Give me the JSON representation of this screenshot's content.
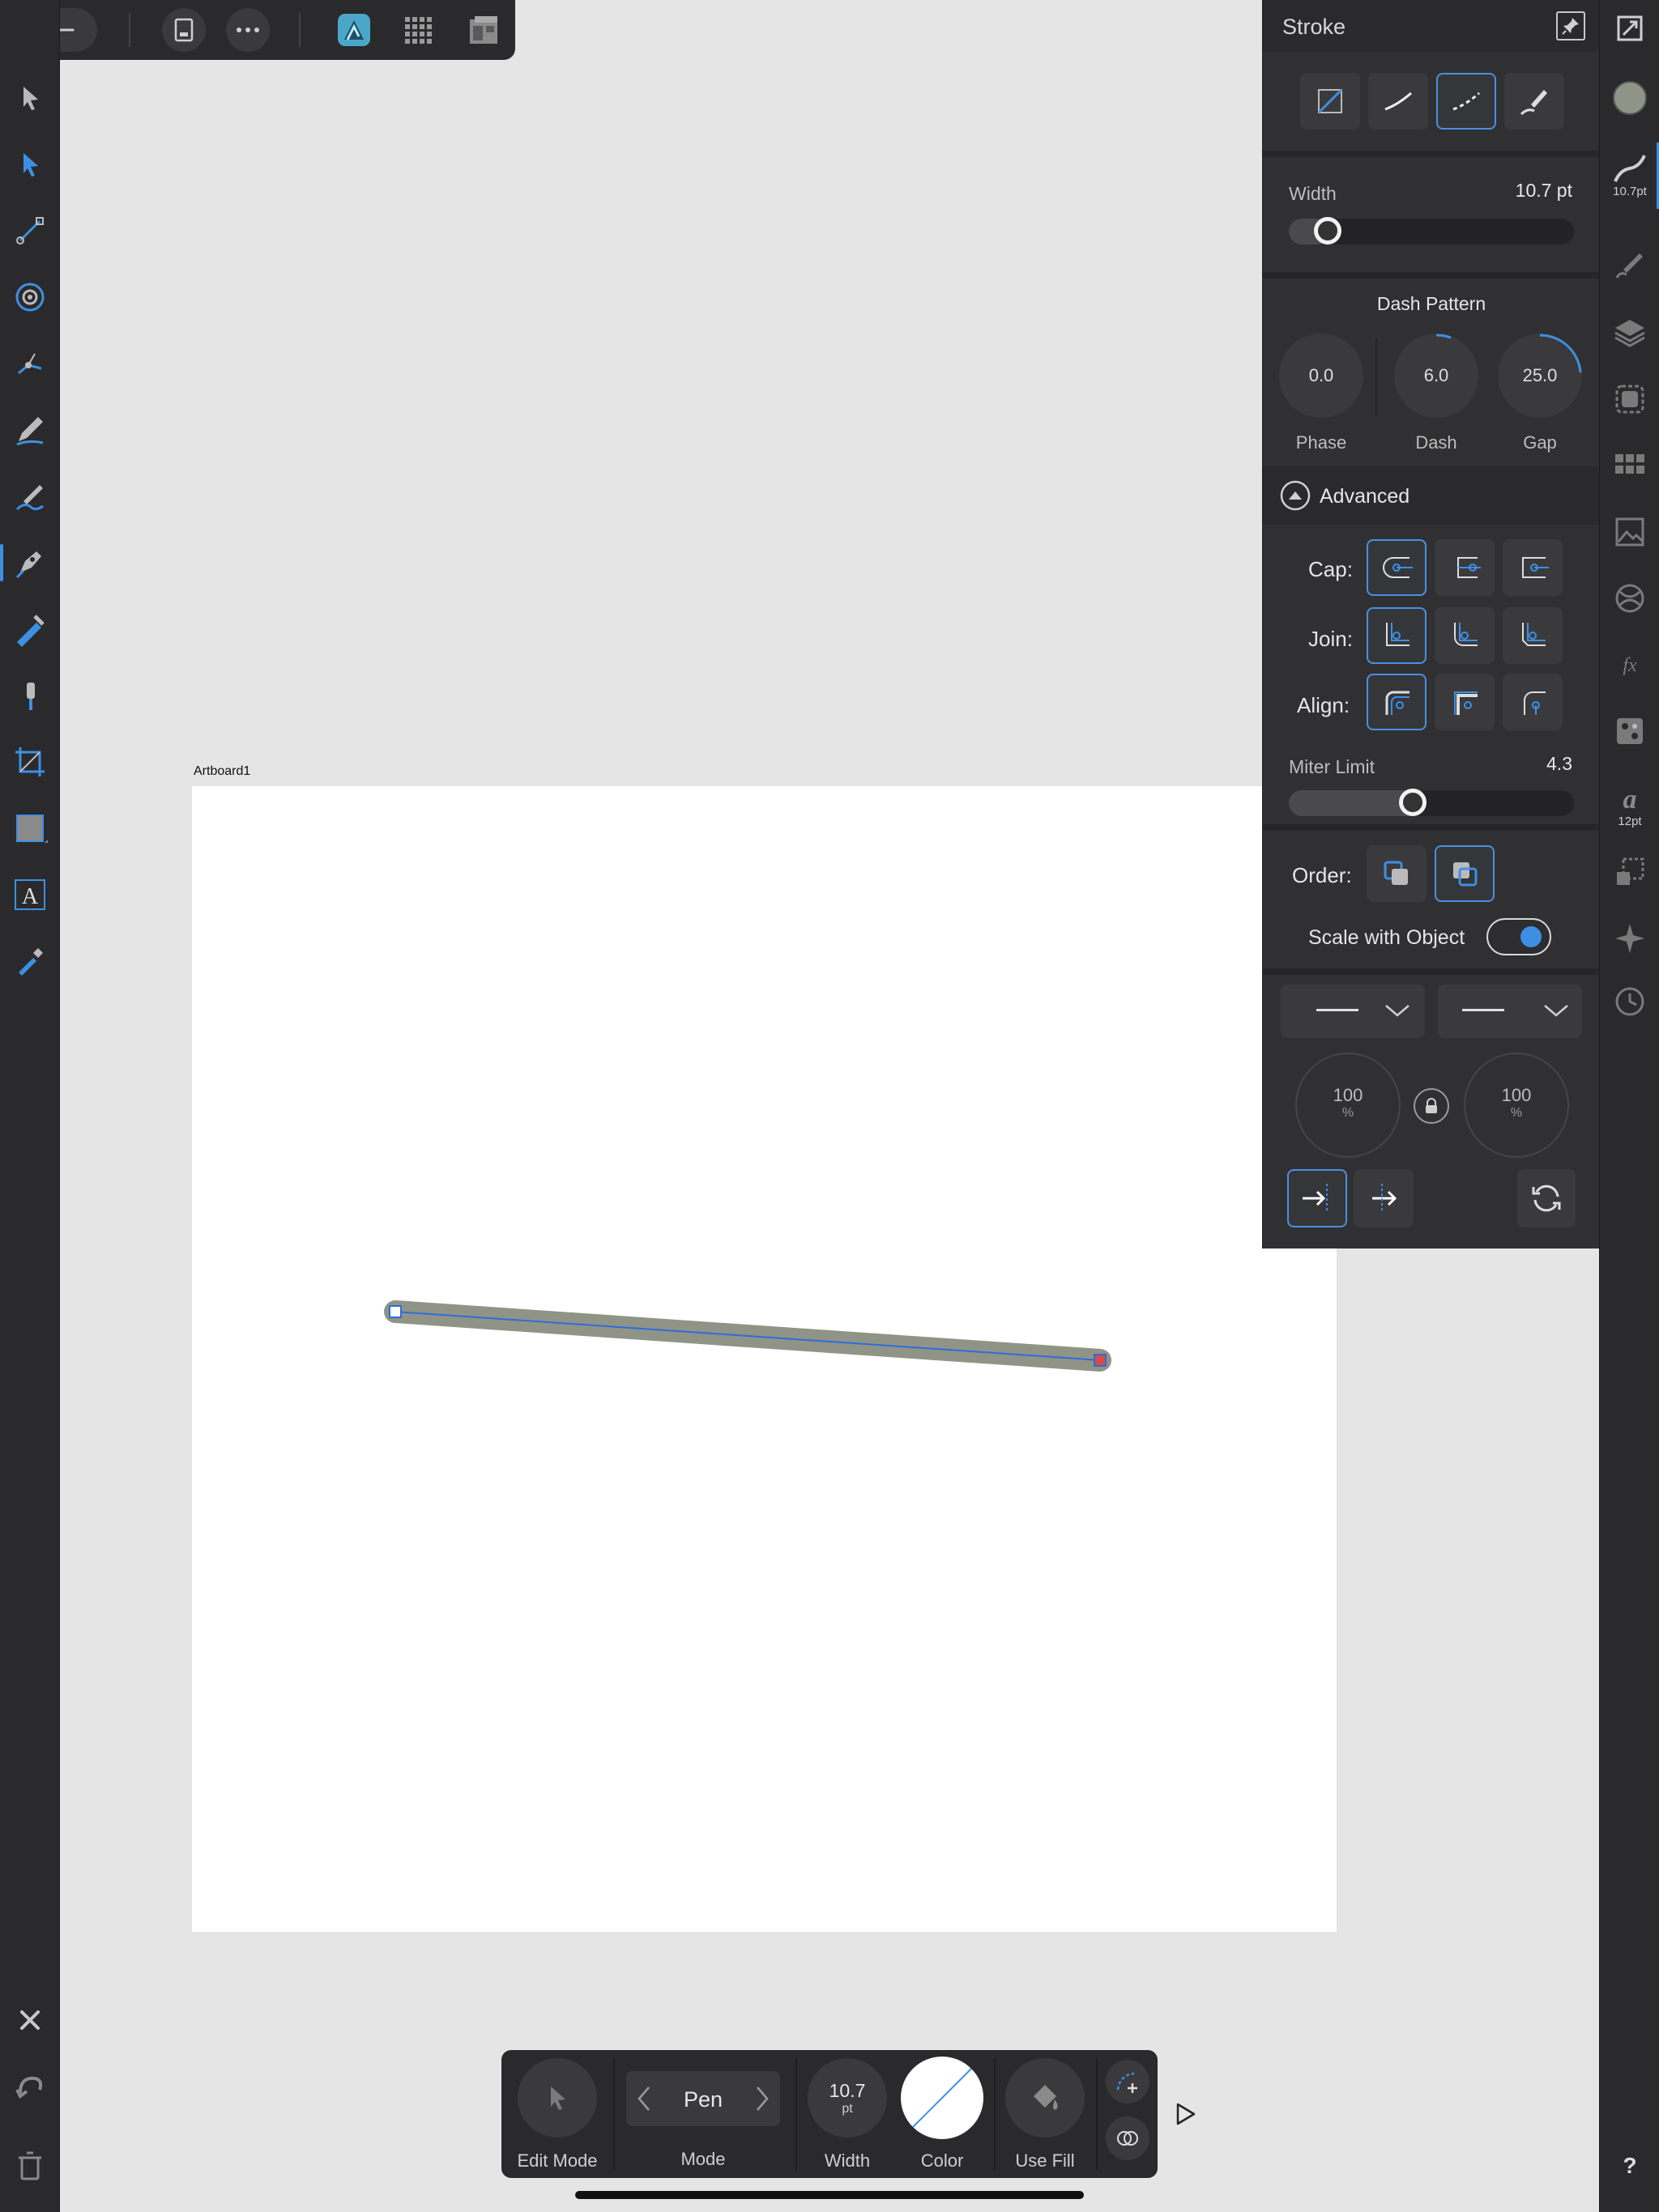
{
  "top_toolbar": {
    "items": [
      "back-icon",
      "document-icon",
      "more-icon",
      "designer-persona-icon",
      "pixel-persona-icon",
      "export-persona-icon"
    ]
  },
  "left_tools": [
    "move-tool-icon",
    "node-tool-icon",
    "corner-tool-icon",
    "point-transform-icon",
    "vector-crop-icon",
    "pencil-icon",
    "vector-brush-icon",
    "pen-tool-icon",
    "fill-tool-icon",
    "transparency-tool-icon",
    "artboard-tool-icon",
    "rectangle-tool-icon",
    "text-tool-icon",
    "color-picker-icon"
  ],
  "left_bottom": [
    "close-icon",
    "undo-icon",
    "delete-icon"
  ],
  "canvas": {
    "artboard_label": "Artboard1"
  },
  "stroke_panel": {
    "title": "Stroke",
    "width_label": "Width",
    "width_value": "10.7 pt",
    "width_fraction": 0.1,
    "dash_title": "Dash Pattern",
    "dials": [
      {
        "value": "0.0",
        "caption": "Phase"
      },
      {
        "value": "6.0",
        "caption": "Dash"
      },
      {
        "value": "25.0",
        "caption": "Gap"
      }
    ],
    "advanced_label": "Advanced",
    "cap_label": "Cap:",
    "join_label": "Join:",
    "align_label": "Align:",
    "miter_label": "Miter Limit",
    "miter_value": "4.3",
    "miter_fraction": 0.44,
    "order_label": "Order:",
    "scale_label": "Scale with Object",
    "scale_on": true,
    "arrow_scale_left": "100",
    "arrow_scale_right": "100",
    "percent": "%"
  },
  "right_bar": {
    "stroke_width_label": "10.7pt",
    "text_size_label": "12pt",
    "help": "?"
  },
  "context_toolbar": {
    "edit_mode": "Edit Mode",
    "mode_value": "Pen",
    "mode_label": "Mode",
    "width_value": "10.7",
    "width_unit": "pt",
    "width_label": "Width",
    "color_label": "Color",
    "use_fill_label": "Use Fill"
  },
  "colors": {
    "accent": "#3d8fe4",
    "stroke_fill": "#8f9486"
  }
}
